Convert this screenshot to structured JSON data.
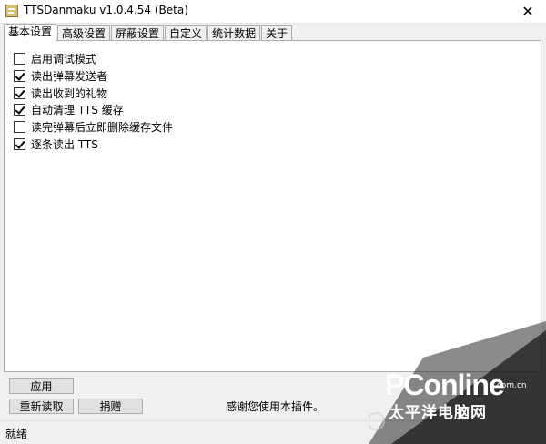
{
  "window": {
    "title": "TTSDanmaku v1.0.4.54 (Beta)",
    "close_glyph": "✕"
  },
  "tabs": [
    {
      "label": "基本设置",
      "active": true
    },
    {
      "label": "高级设置",
      "active": false
    },
    {
      "label": "屏蔽设置",
      "active": false
    },
    {
      "label": "自定义",
      "active": false
    },
    {
      "label": "统计数据",
      "active": false
    },
    {
      "label": "关于",
      "active": false
    }
  ],
  "options": [
    {
      "label": "启用调试模式",
      "checked": false
    },
    {
      "label": "读出弹幕发送者",
      "checked": true
    },
    {
      "label": "读出收到的礼物",
      "checked": true
    },
    {
      "label": "自动清理 TTS 缓存",
      "checked": true
    },
    {
      "label": "读完弹幕后立即删除缓存文件",
      "checked": false
    },
    {
      "label": "逐条读出 TTS",
      "checked": true
    }
  ],
  "buttons": {
    "apply": "应用",
    "reload": "重新读取",
    "donate": "捐赠"
  },
  "thanks_text": "感谢您使用本插件。",
  "status_text": "就绪",
  "watermark": {
    "brand": "PConline",
    "domain": ".com.cn",
    "cn_name": "太平洋电脑网"
  }
}
